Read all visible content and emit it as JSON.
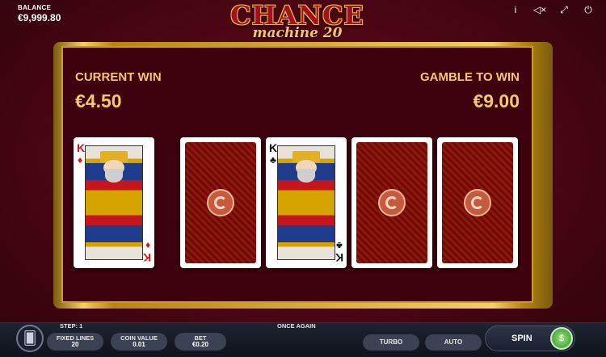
{
  "balance": {
    "label": "BALANCE",
    "value": "€9,999.80"
  },
  "logo": {
    "title": "CHANCE",
    "subtitle": "machine 20"
  },
  "top_icons": [
    "info-icon",
    "mute-icon",
    "fullscreen-icon",
    "power-icon"
  ],
  "top_icon_glyphs": {
    "info": "i",
    "mute": "◁×",
    "fullscreen": "⤢",
    "power": "⏻"
  },
  "gamble": {
    "current_win_label": "CURRENT WIN",
    "current_win_value": "€4.50",
    "gamble_to_win_label": "GAMBLE TO WIN",
    "gamble_to_win_value": "€9.00"
  },
  "cards": [
    {
      "state": "face",
      "rank": "K",
      "suit": "♦",
      "color": "red"
    },
    {
      "state": "back"
    },
    {
      "state": "face",
      "rank": "K",
      "suit": "♣",
      "color": "black"
    },
    {
      "state": "back"
    },
    {
      "state": "back"
    }
  ],
  "bottom": {
    "step": "STEP: 1",
    "fixed_lines_label": "FIXED LINES",
    "fixed_lines_value": "20",
    "coin_value_label": "COIN VALUE",
    "coin_value_value": "0.01",
    "bet_label": "BET",
    "bet_value": "€0.20",
    "message": "ONCE AGAIN",
    "turbo_label": "TURBO",
    "auto_label": "AUTO",
    "spin_label": "SPIN"
  },
  "colors": {
    "accent_gold": "#f3c96a",
    "bg_red": "#4a0612",
    "bar": "#1d2331"
  }
}
